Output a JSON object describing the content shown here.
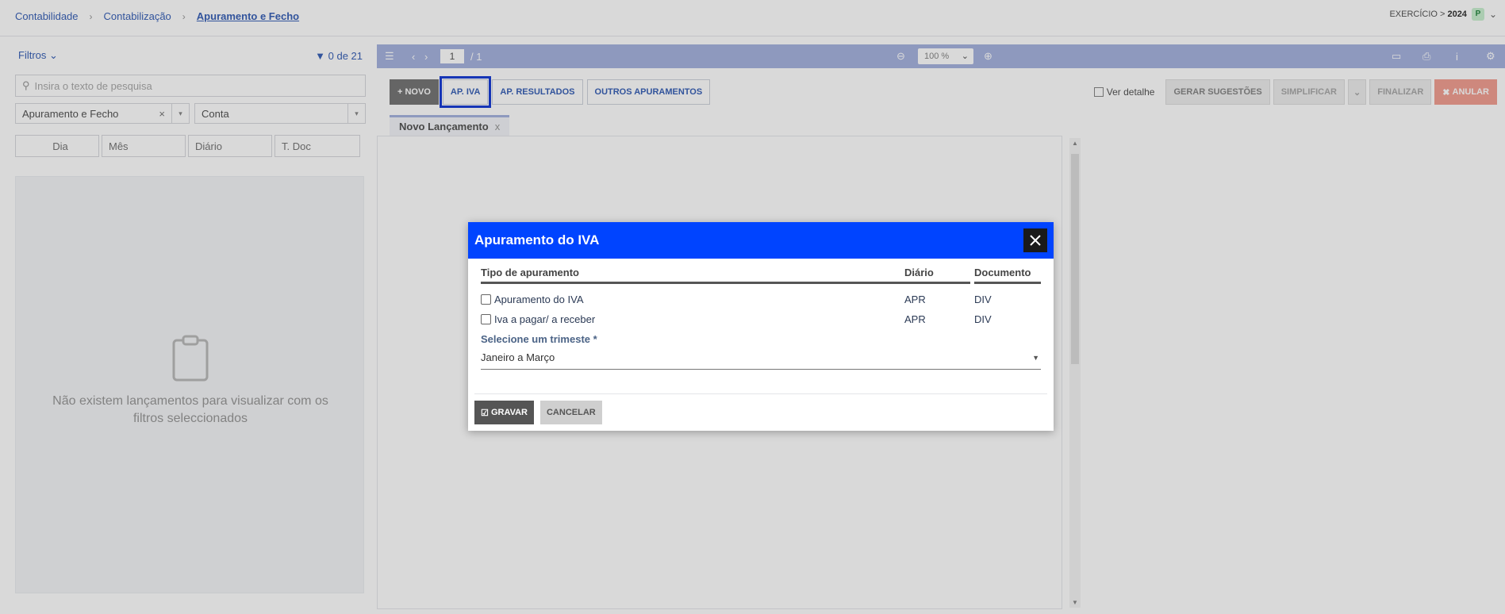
{
  "breadcrumb": [
    "Contabilidade",
    "Contabilização",
    "Apuramento e Fecho"
  ],
  "exercise": {
    "label": "EXERCÍCIO >",
    "year": "2024",
    "badge": "P"
  },
  "left": {
    "filters_label": "Filtros",
    "count": "0 de 21",
    "search_placeholder": "Insira o texto de pesquisa",
    "filter_value": "Apuramento e Fecho",
    "conta_placeholder": "Conta",
    "grid_cols": [
      "Dia",
      "Mês",
      "Diário",
      "T. Doc"
    ],
    "empty_msg_1": "Não existem lançamentos para visualizar com os",
    "empty_msg_2": "filtros seleccionados"
  },
  "toolbar": {
    "page": "1",
    "total": "/ 1",
    "zoom": "100 %"
  },
  "buttons": {
    "novo": "NOVO",
    "ap_iva": "AP. IVA",
    "ap_resultados": "AP. RESULTADOS",
    "outros": "OUTROS APURAMENTOS",
    "ver_detalhe": "Ver detalhe",
    "gerar": "GERAR SUGESTÕES",
    "simplificar": "SIMPLIFICAR",
    "finalizar": "FINALIZAR",
    "anular": "ANULAR"
  },
  "tab": {
    "label": "Novo Lançamento",
    "close": "x"
  },
  "modal": {
    "title": "Apuramento do IVA",
    "col_tipo": "Tipo de apuramento",
    "col_diario": "Diário",
    "col_doc": "Documento",
    "rows": [
      {
        "label": "Apuramento do IVA",
        "diario": "APR",
        "doc": "DIV"
      },
      {
        "label": "Iva a pagar/ a receber",
        "diario": "APR",
        "doc": "DIV"
      }
    ],
    "select_label": "Selecione um trimeste *",
    "select_value": "Janeiro a Março",
    "save": "GRAVAR",
    "cancel": "CANCELAR"
  },
  "colors": {
    "modal_header": "#0044ff",
    "toolbar": "#a7b4e0",
    "highlight": "#1a3fd6"
  }
}
